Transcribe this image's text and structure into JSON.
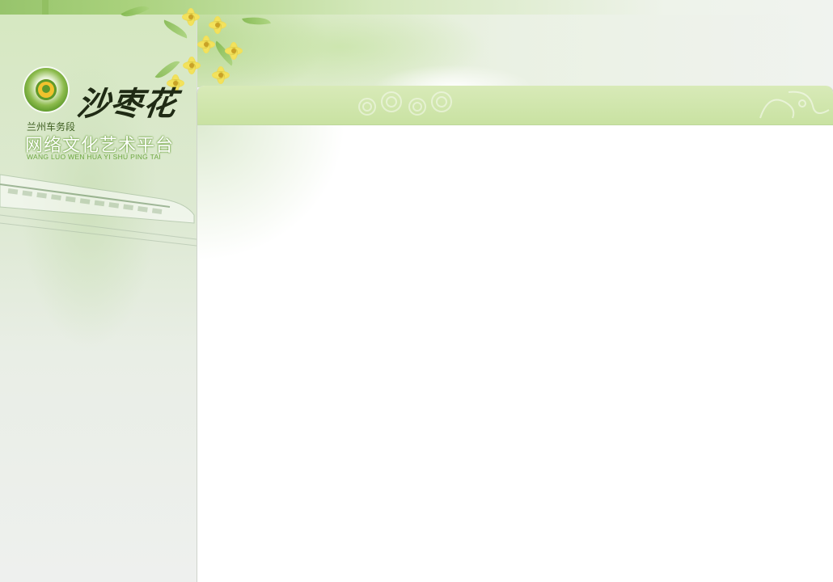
{
  "branding": {
    "calligraphy_title": "沙枣花",
    "organization": "兰州车务段",
    "platform_name": "网络文化艺术平台",
    "platform_pinyin": "WANG LUO WEN HUA YI SHU PING TAI",
    "emblem_icon": "railway-emblem-icon"
  },
  "colors": {
    "accent_green": "#8abb58",
    "header_green": "#c9e2a2",
    "brand_text_green": "#6ea842",
    "emblem_yellow": "#f1c22d"
  },
  "main_panel": {
    "header_title": ""
  }
}
